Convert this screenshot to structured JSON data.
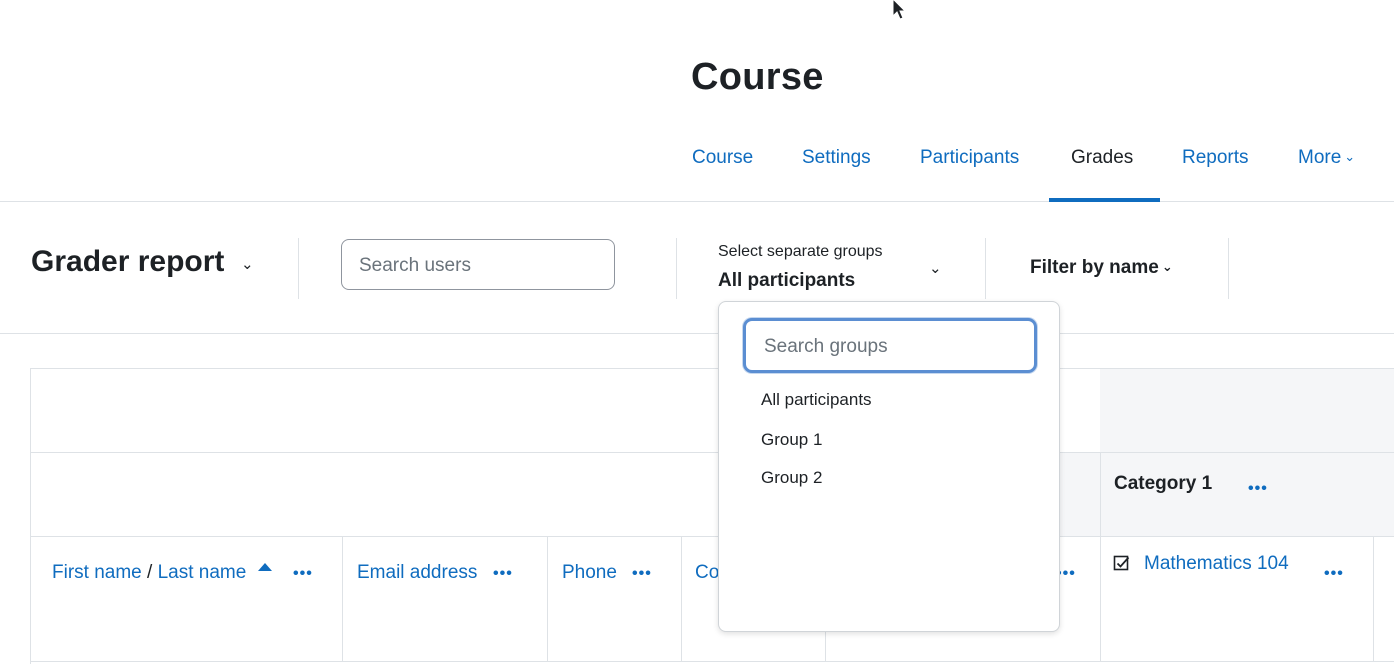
{
  "page_title": "Course",
  "nav_tabs": [
    {
      "label": "Course"
    },
    {
      "label": "Settings"
    },
    {
      "label": "Participants"
    },
    {
      "label": "Grades"
    },
    {
      "label": "Reports"
    },
    {
      "label": "More"
    }
  ],
  "active_tab": "Grades",
  "report": {
    "title": "Grader report",
    "search_users_placeholder": "Search users",
    "group_selector_label": "Select separate groups",
    "group_selector_value": "All participants",
    "filter_by_name": "Filter by name"
  },
  "group_dropdown": {
    "search_placeholder": "Search groups",
    "options": [
      "All participants",
      "Group 1",
      "Group 2"
    ]
  },
  "table": {
    "category_title": "Category 1",
    "col_first_name": "First name",
    "col_name_separator": "/",
    "col_last_name": "Last name",
    "col_email": "Email address",
    "col_phone": "Phone",
    "col_partial": "Co",
    "col_grade_item": "Mathematics 104",
    "menu_dots": "•••"
  },
  "colors": {
    "link": "#0f6cbf",
    "text": "#1d2125",
    "active_underline": "#0f6cbf",
    "focus_ring": "#5b8ed2"
  }
}
